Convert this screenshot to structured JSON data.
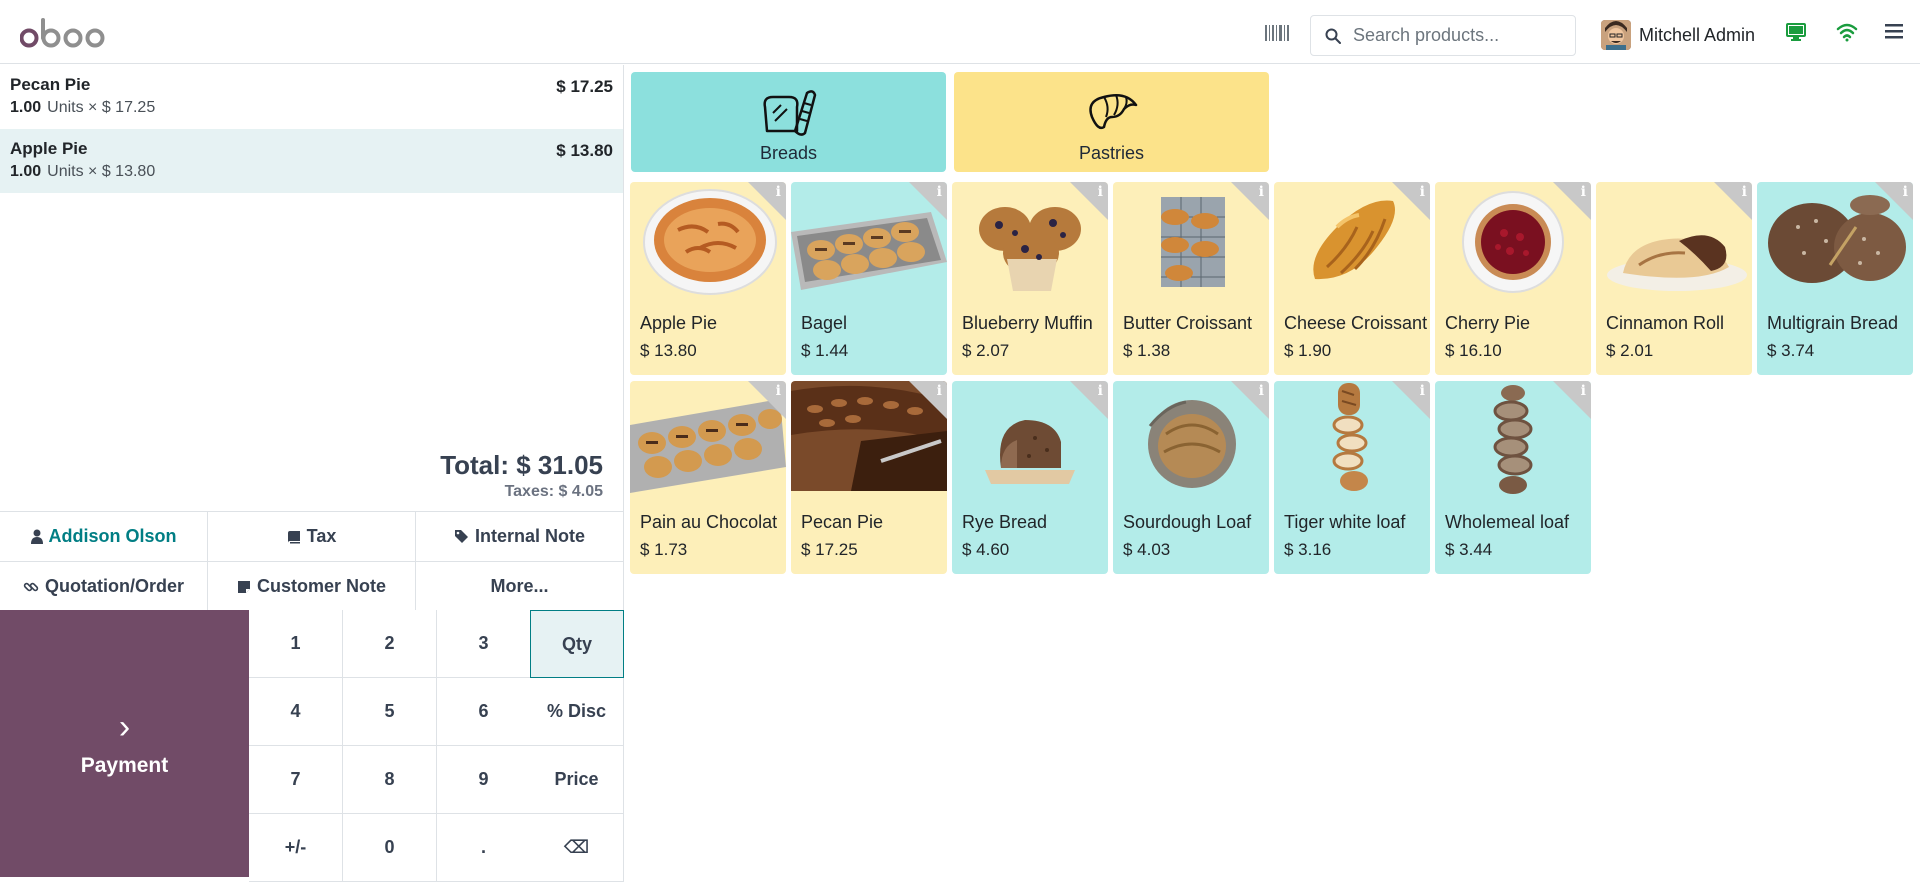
{
  "header": {
    "brand": "odoo",
    "search_placeholder": "Search products...",
    "user_name": "Mitchell Admin",
    "icons": [
      "barcode-icon",
      "search-icon",
      "monitor-icon",
      "wifi-icon",
      "menu-icon"
    ]
  },
  "order": {
    "lines": [
      {
        "name": "Pecan Pie",
        "price": "$ 17.25",
        "qty": "1.00",
        "unit_text": "Units × $ 17.25"
      },
      {
        "name": "Apple Pie",
        "price": "$ 13.80",
        "qty": "1.00",
        "unit_text": "Units × $ 13.80"
      }
    ],
    "total": "Total: $ 31.05",
    "taxes": "Taxes: $ 4.05"
  },
  "controls": {
    "customer": "Addison Olson",
    "tax": "Tax",
    "internal_note": "Internal Note",
    "quotation": "Quotation/Order",
    "customer_note": "Customer Note",
    "more": "More..."
  },
  "payment": {
    "label": "Payment",
    "chevron": "›"
  },
  "numpad": {
    "keys": [
      "1",
      "2",
      "3",
      "Qty",
      "4",
      "5",
      "6",
      "% Disc",
      "7",
      "8",
      "9",
      "Price",
      "+/-",
      "0",
      ".",
      "⌫"
    ],
    "active_mode": "Qty"
  },
  "categories": [
    {
      "label": "Breads",
      "color": "#8ce0dd"
    },
    {
      "label": "Pastries",
      "color": "#fce38a"
    }
  ],
  "products": [
    {
      "name": "Apple Pie",
      "price": "$ 13.80",
      "bg": "yellow"
    },
    {
      "name": "Bagel",
      "price": "$ 1.44",
      "bg": "cyan"
    },
    {
      "name": "Blueberry Muffin",
      "price": "$ 2.07",
      "bg": "yellow"
    },
    {
      "name": "Butter Croissant",
      "price": "$ 1.38",
      "bg": "yellow"
    },
    {
      "name": "Cheese Croissant",
      "price": "$ 1.90",
      "bg": "yellow"
    },
    {
      "name": "Cherry Pie",
      "price": "$ 16.10",
      "bg": "yellow"
    },
    {
      "name": "Cinnamon Roll",
      "price": "$ 2.01",
      "bg": "yellow"
    },
    {
      "name": "Multigrain Bread",
      "price": "$ 3.74",
      "bg": "cyan"
    },
    {
      "name": "Pain au Chocolat",
      "price": "$ 1.73",
      "bg": "yellow"
    },
    {
      "name": "Pecan Pie",
      "price": "$ 17.25",
      "bg": "yellow"
    },
    {
      "name": "Rye Bread",
      "price": "$ 4.60",
      "bg": "cyan"
    },
    {
      "name": "Sourdough Loaf",
      "price": "$ 4.03",
      "bg": "cyan"
    },
    {
      "name": "Tiger white loaf",
      "price": "$ 3.16",
      "bg": "cyan"
    },
    {
      "name": "Wholemeal loaf",
      "price": "$ 3.44",
      "bg": "cyan"
    }
  ],
  "colors": {
    "brand": "#714b67",
    "accent": "#017e84"
  }
}
